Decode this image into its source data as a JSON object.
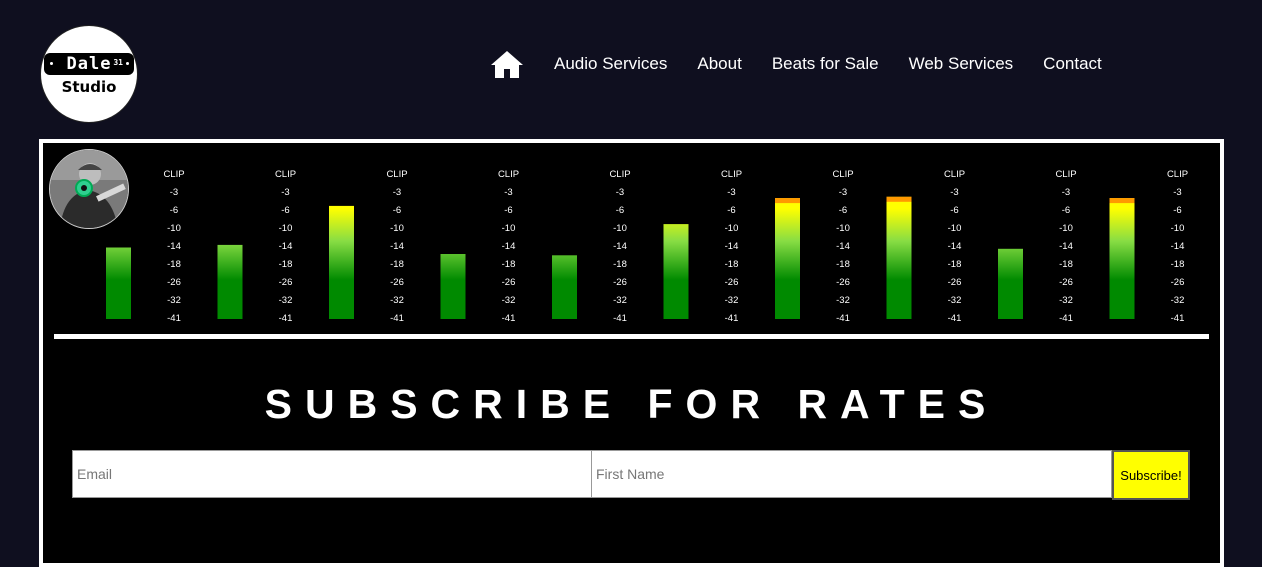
{
  "logo": {
    "word": "Dale",
    "number": "31",
    "studio": "Studio"
  },
  "nav": {
    "items": [
      {
        "label": "Audio Services"
      },
      {
        "label": "About"
      },
      {
        "label": "Beats for Sale"
      },
      {
        "label": "Web Services"
      },
      {
        "label": "Contact"
      }
    ]
  },
  "meter": {
    "scale_labels": [
      "CLIP",
      "-3",
      "-6",
      "-10",
      "-14",
      "-18",
      "-26",
      "-32",
      "-41"
    ],
    "levels": [
      0.55,
      0.57,
      0.87,
      0.5,
      0.49,
      0.73,
      0.93,
      0.94,
      0.54,
      0.93
    ],
    "colors": {
      "low": "#008a00",
      "mid": "#88dd44",
      "high": "#ffff00",
      "peak": "#ff9900"
    }
  },
  "subscribe": {
    "title": "SUBSCRIBE FOR RATES",
    "email_placeholder": "Email",
    "name_placeholder": "First Name",
    "button_label": "Subscribe!"
  },
  "colors": {
    "background": "#0f0f1f",
    "panel": "#000000",
    "accent": "#ffff00"
  }
}
